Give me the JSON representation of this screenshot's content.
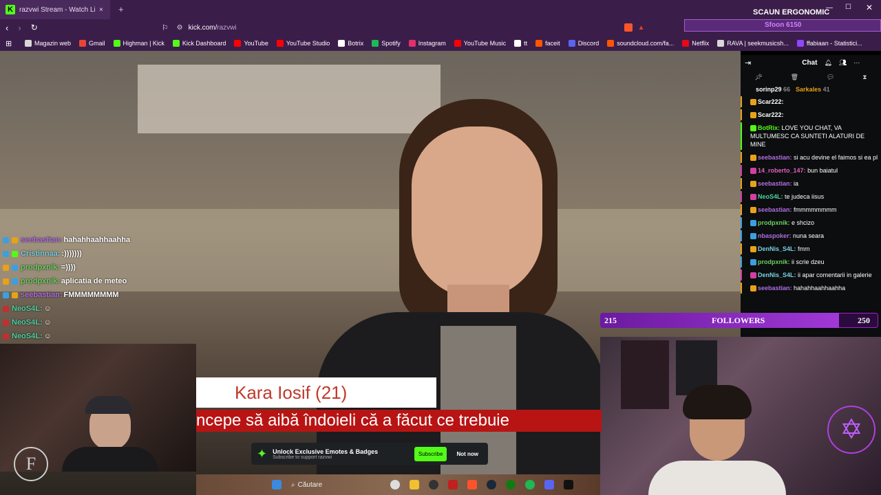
{
  "browser": {
    "tab_title": "razvwi Stream - Watch Live o",
    "new_tab": "+",
    "url_host": "kick.com/",
    "url_path": "razvwi",
    "window_title_overlay": "SCAUN ERGONOMIC",
    "donation_overlay": "Sfoon 6150"
  },
  "bookmarks": [
    {
      "label": "Magazin web",
      "color": "#d8d8d8"
    },
    {
      "label": "Gmail",
      "color": "#ea4335"
    },
    {
      "label": "Highman | Kick",
      "color": "#53fc18"
    },
    {
      "label": "Kick Dashboard",
      "color": "#53fc18"
    },
    {
      "label": "YouTube",
      "color": "#ff0000"
    },
    {
      "label": "YouTube Studio",
      "color": "#ff0000"
    },
    {
      "label": "Botrix",
      "color": "#ffffff"
    },
    {
      "label": "Spotify",
      "color": "#1db954"
    },
    {
      "label": "Instagram",
      "color": "#e1306c"
    },
    {
      "label": "YouTube Music",
      "color": "#ff0000"
    },
    {
      "label": "tt",
      "color": "#ffffff"
    },
    {
      "label": "faceit",
      "color": "#ff5500"
    },
    {
      "label": "Discord",
      "color": "#5865f2"
    },
    {
      "label": "soundcloud.com/fa...",
      "color": "#ff5500"
    },
    {
      "label": "Netflix",
      "color": "#e50914"
    },
    {
      "label": "RAVA | seekmusicsh...",
      "color": "#d8d8d8"
    },
    {
      "label": "ffabiaan - Statistici...",
      "color": "#9146ff"
    }
  ],
  "chat": {
    "title": "Chat",
    "top_gifters": [
      {
        "name": "sorinp29",
        "count": "66"
      },
      {
        "name": "Sarkales",
        "count": "41"
      }
    ],
    "messages": [
      {
        "user": "Scar222:",
        "text": "",
        "color": "#ffffff",
        "border": "#e6a21a"
      },
      {
        "user": "Scar222:",
        "text": "",
        "color": "#ffffff",
        "border": "#e6a21a"
      },
      {
        "user": "BotRix:",
        "text": "LOVE YOU CHAT, VA MULTUMESC CA SUNTETI ALATURI DE MINE",
        "color": "#53fc18",
        "border": "#53fc18"
      },
      {
        "user": "seebastian:",
        "text": "si acu devine el faimos si ea pl",
        "color": "#b06ee0",
        "border": "#e6a21a"
      },
      {
        "user": "14_roberto_147:",
        "text": "bun baiatul",
        "color": "#e060c0",
        "border": "#d040a0"
      },
      {
        "user": "seebastian:",
        "text": "ia",
        "color": "#b06ee0",
        "border": "#e6a21a"
      },
      {
        "user": "NeoS4L:",
        "text": "te judeca iisus",
        "color": "#4fd0a0",
        "border": "#d040a0"
      },
      {
        "user": "seebastian:",
        "text": "fmmmmmmmm",
        "color": "#b06ee0",
        "border": "#e6a21a"
      },
      {
        "user": "prodpxnik:",
        "text": "e shcizo",
        "color": "#6ad060",
        "border": "#3aa0e0"
      },
      {
        "user": "nbaspoker:",
        "text": "nuna seara",
        "color": "#b06ee0",
        "border": "#3aa0e0"
      },
      {
        "user": "DenNis_S4L:",
        "text": "fmm",
        "color": "#7ad0e0",
        "border": "#e6a21a"
      },
      {
        "user": "prodpxnik:",
        "text": "ii scrie dzeu",
        "color": "#6ad060",
        "border": "#3aa0e0"
      },
      {
        "user": "DenNis_S4L:",
        "text": "ii apar comentarii in galerie",
        "color": "#7ad0e0",
        "border": "#d040a0"
      },
      {
        "user": "seebastian:",
        "text": "hahahhaahhaahha",
        "color": "#b06ee0",
        "border": "#e6a21a"
      }
    ]
  },
  "overlay_chat": [
    {
      "user": "seebastian:",
      "text": "hahahhaahhaahha",
      "color": "#b06ee0"
    },
    {
      "user": "Cristinnaa:",
      "text": ":)))))))",
      "color": "#7ad0e0"
    },
    {
      "user": "prodpxnik:",
      "text": "=))))",
      "color": "#6ad060"
    },
    {
      "user": "prodpxnik:",
      "text": "aplicatia de meteo",
      "color": "#6ad060"
    },
    {
      "user": "seebastian:",
      "text": "FMMMMMMMM",
      "color": "#b06ee0"
    },
    {
      "user": "NeoS4L:",
      "text": "",
      "color": "#4fd0a0"
    },
    {
      "user": "NeoS4L:",
      "text": "",
      "color": "#4fd0a0"
    },
    {
      "user": "NeoS4L:",
      "text": "",
      "color": "#4fd0a0"
    }
  ],
  "followers": {
    "current": "215",
    "label": "FOLLOWERS",
    "goal": "250",
    "progress": 0.86
  },
  "lower_third": {
    "name": "Kara Iosif (21)",
    "subtitle": "ncepe să aibă îndoieli că a făcut ce trebuie"
  },
  "unlock": {
    "title": "Unlock Exclusive Emotes & Badges",
    "subtitle": "Subscribe to support razvwi",
    "subscribe": "Subscribe",
    "not_now": "Not now"
  },
  "taskbar": {
    "search": "Căutare"
  },
  "colors": {
    "kick_green": "#53fc18",
    "browser_purple": "#3b1d4a",
    "followers_purple": "#a038d6",
    "subtitle_red": "#b81414"
  }
}
